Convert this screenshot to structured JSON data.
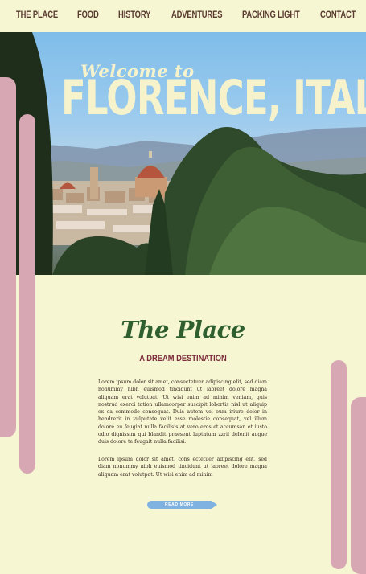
{
  "nav": {
    "items": [
      "THE PLACE",
      "FOOD",
      "HISTORY",
      "ADVENTURES",
      "PACKING LIGHT",
      "CONTACT"
    ]
  },
  "hero": {
    "welcome": "Welcome to",
    "title": "FLORENCE, ITALY"
  },
  "section": {
    "title": "The Place",
    "subtitle": "A DREAM DESTINATION",
    "paragraph1": "Lorem ipsum dolor sit amet, consectetuer adipiscing elit, sed diam nonummy nibh euismod tincidunt ut laoreet dolore magna aliquam erat volutpat. Ut wisi enim ad minim veniam, quis nostrud exerci tation ullamcorper suscipit lobortis nisl ut aliquip ex ea commodo consequat. Duis autem vel eum iriure dolor in hendrerit in vulputate velit esse molestie consequat, vel illum dolore eu feugiat nulla facilisis at vero eros et accumsan et iusto odio dignissim qui blandit praesent luptatum zzril delenit augue duis dolore te feugait nulla facilisi.",
    "paragraph2": "Lorem ipsum dolor sit amet, cons ectetuer adipiscing elit, sed diam nonummy nibh euismod tincidunt ut laoreet dolore magna aliquam erat volutpat. Ut wisi enim ad minim",
    "button_label": "READ MORE"
  },
  "colors": {
    "background": "#f6f6d2",
    "nav_text": "#5a3a31",
    "title_green": "#2f5e2f",
    "subtitle_maroon": "#7a2a3a",
    "accent_pink": "#d8a7b4",
    "button_blue": "#7fb2e0"
  }
}
